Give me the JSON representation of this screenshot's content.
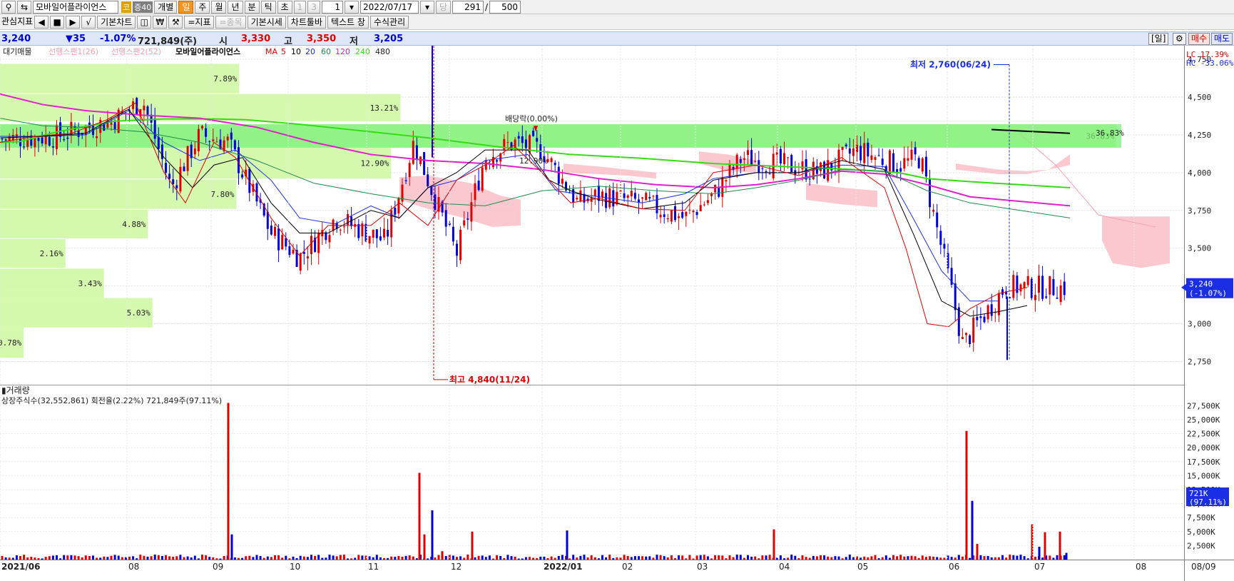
{
  "toolbar": {
    "stock_name": "모바일어플라이언스",
    "badge_market": "코",
    "badge_margin": "증40",
    "individual": "개별",
    "periods": [
      "일",
      "주",
      "월",
      "년",
      "분",
      "틱",
      "초"
    ],
    "active_period": "일",
    "spin_value": "1",
    "dis_one": "1",
    "dis_three": "3",
    "date": "2022/07/17",
    "dang_label": "당",
    "count": "291",
    "slash": "/",
    "total": "500",
    "btn_watchlist": "관심지표",
    "btn_basic_chart": "기본차트",
    "btn_indicator": "=지표",
    "btn_item": "=종목",
    "btn_basic_quote": "기본시세",
    "btn_chart_toolbar": "차트툴바",
    "btn_text_tool": "텍스트 창",
    "btn_formula": "수식관리"
  },
  "info": {
    "price": "3,240",
    "change": "▼35",
    "change_pct": "-1.07%",
    "volume": "721,849(주)",
    "open_label": "시",
    "open": "3,330",
    "high_label": "고",
    "high": "3,350",
    "low_label": "저",
    "low": "3,205",
    "period_btn": "[일]",
    "buy_btn": "매수",
    "sell_btn": "매도"
  },
  "colors": {
    "up": "#e00000",
    "down": "#0000d8",
    "ma5": "#e00000",
    "ma10": "#000000",
    "ma20": "#1a2ee6",
    "ma60": "#1f8a4a",
    "ma120": "#e020c8",
    "ma240": "#33dd11",
    "volume_profile": "#ccf7a0",
    "cloud": "#fbbec8"
  },
  "chart_data": [
    {
      "type": "candlestick",
      "legend": [
        "대기매물",
        "선행스팬1(26)",
        "선행스팬2(52)",
        "모바일어플라이언스",
        "MA",
        "5",
        "10",
        "20",
        "60",
        "120",
        "240",
        "480"
      ],
      "y_ticks": [
        2750,
        3000,
        3250,
        3500,
        3750,
        4000,
        4250,
        4500,
        4750
      ],
      "ylim": [
        2620,
        4840
      ],
      "x_ticks": [
        "2021/06",
        "08",
        "09",
        "10",
        "11",
        "12",
        "2022/01",
        "02",
        "03",
        "04",
        "05",
        "06",
        "07",
        "08",
        "08/09"
      ],
      "overlay_legend": [
        "LC 17.39%",
        "HC -33.06%"
      ],
      "price_flag": [
        "3,240",
        "(-1.07%)"
      ],
      "annotations": {
        "high": "최고 4,840(11/24)",
        "low": "최저 2,760(06/24)",
        "dividend": "배당락(0.00%)",
        "dividend_pct": "12.90%",
        "band_pct": "36.83%"
      },
      "volume_profile": [
        {
          "low": 4165,
          "high": 4320,
          "pct": "36.83%"
        },
        {
          "low": 3960,
          "high": 4165,
          "pct": "12.90%"
        },
        {
          "low": 4340,
          "high": 4520,
          "pct": "13.21%"
        },
        {
          "low": 4525,
          "high": 4720,
          "pct": "7.89%"
        },
        {
          "low": 3760,
          "high": 3955,
          "pct": "7.80%"
        },
        {
          "low": 3565,
          "high": 3755,
          "pct": "4.88%"
        },
        {
          "low": 3370,
          "high": 3560,
          "pct": "2.16%"
        },
        {
          "low": 3170,
          "high": 3365,
          "pct": "3.43%"
        },
        {
          "low": 2975,
          "high": 3170,
          "pct": "5.03%"
        },
        {
          "low": 2775,
          "high": 2975,
          "pct": "0.78%"
        }
      ],
      "ma240": [
        [
          0,
          4200
        ],
        [
          28,
          4205
        ],
        [
          80,
          4270
        ],
        [
          160,
          4340
        ],
        [
          230,
          4355
        ],
        [
          300,
          4355
        ],
        [
          345,
          4350
        ],
        [
          420,
          4320
        ],
        [
          500,
          4280
        ],
        [
          600,
          4230
        ],
        [
          700,
          4170
        ],
        [
          800,
          4120
        ],
        [
          900,
          4095
        ],
        [
          1000,
          4060
        ],
        [
          1100,
          4040
        ],
        [
          1200,
          4020
        ],
        [
          1260,
          4000
        ],
        [
          1300,
          3960
        ],
        [
          1360,
          3940
        ],
        [
          1500,
          3900
        ]
      ],
      "ma120": [
        [
          0,
          4520
        ],
        [
          60,
          4450
        ],
        [
          120,
          4410
        ],
        [
          200,
          4380
        ],
        [
          280,
          4360
        ],
        [
          360,
          4300
        ],
        [
          440,
          4200
        ],
        [
          520,
          4120
        ],
        [
          600,
          4080
        ],
        [
          680,
          4060
        ],
        [
          760,
          4020
        ],
        [
          840,
          3960
        ],
        [
          920,
          3920
        ],
        [
          1000,
          3900
        ],
        [
          1060,
          3920
        ],
        [
          1120,
          3960
        ],
        [
          1180,
          4010
        ],
        [
          1240,
          3990
        ],
        [
          1300,
          3920
        ],
        [
          1360,
          3840
        ],
        [
          1500,
          3780
        ]
      ],
      "ma60": [
        [
          0,
          4360
        ],
        [
          60,
          4310
        ],
        [
          120,
          4300
        ],
        [
          200,
          4270
        ],
        [
          280,
          4200
        ],
        [
          360,
          4080
        ],
        [
          440,
          3930
        ],
        [
          520,
          3860
        ],
        [
          600,
          3800
        ],
        [
          680,
          3780
        ],
        [
          760,
          3880
        ],
        [
          840,
          3910
        ],
        [
          920,
          3880
        ],
        [
          1000,
          3860
        ],
        [
          1060,
          3900
        ],
        [
          1120,
          3950
        ],
        [
          1180,
          4020
        ],
        [
          1240,
          4010
        ],
        [
          1300,
          3880
        ],
        [
          1360,
          3800
        ],
        [
          1500,
          3700
        ]
      ],
      "ma20": [
        [
          0,
          4240
        ],
        [
          60,
          4240
        ],
        [
          120,
          4250
        ],
        [
          180,
          4410
        ],
        [
          230,
          4200
        ],
        [
          280,
          4080
        ],
        [
          330,
          4150
        ],
        [
          380,
          3950
        ],
        [
          420,
          3700
        ],
        [
          470,
          3660
        ],
        [
          520,
          3780
        ],
        [
          560,
          3700
        ],
        [
          600,
          3900
        ],
        [
          640,
          3950
        ],
        [
          680,
          4080
        ],
        [
          740,
          4120
        ],
        [
          780,
          3880
        ],
        [
          840,
          3840
        ],
        [
          900,
          3800
        ],
        [
          960,
          3860
        ],
        [
          1000,
          3960
        ],
        [
          1060,
          4000
        ],
        [
          1120,
          4000
        ],
        [
          1180,
          4050
        ],
        [
          1240,
          4040
        ],
        [
          1280,
          3700
        ],
        [
          1320,
          3350
        ],
        [
          1360,
          3150
        ],
        [
          1400,
          3150
        ]
      ],
      "ma10": [
        [
          0,
          4230
        ],
        [
          60,
          4240
        ],
        [
          120,
          4260
        ],
        [
          180,
          4420
        ],
        [
          230,
          4100
        ],
        [
          270,
          3900
        ],
        [
          300,
          4050
        ],
        [
          340,
          4100
        ],
        [
          380,
          3800
        ],
        [
          420,
          3600
        ],
        [
          460,
          3600
        ],
        [
          520,
          3750
        ],
        [
          560,
          3700
        ],
        [
          600,
          3900
        ],
        [
          640,
          4000
        ],
        [
          680,
          4150
        ],
        [
          740,
          4150
        ],
        [
          770,
          3950
        ],
        [
          800,
          3880
        ],
        [
          840,
          3820
        ],
        [
          900,
          3760
        ],
        [
          960,
          3800
        ],
        [
          1000,
          3950
        ],
        [
          1060,
          4000
        ],
        [
          1120,
          4000
        ],
        [
          1180,
          4080
        ],
        [
          1240,
          4020
        ],
        [
          1280,
          3600
        ],
        [
          1320,
          3150
        ],
        [
          1360,
          3050
        ],
        [
          1400,
          3080
        ],
        [
          1440,
          3120
        ]
      ],
      "ma5": [
        [
          0,
          4200
        ],
        [
          50,
          4240
        ],
        [
          100,
          4260
        ],
        [
          150,
          4350
        ],
        [
          190,
          4460
        ],
        [
          230,
          4000
        ],
        [
          260,
          3800
        ],
        [
          300,
          4200
        ],
        [
          330,
          4100
        ],
        [
          380,
          3700
        ],
        [
          420,
          3450
        ],
        [
          460,
          3650
        ],
        [
          520,
          3650
        ],
        [
          560,
          3800
        ],
        [
          600,
          3650
        ],
        [
          640,
          3950
        ],
        [
          680,
          4050
        ],
        [
          720,
          4180
        ],
        [
          760,
          4000
        ],
        [
          800,
          3800
        ],
        [
          840,
          3830
        ],
        [
          900,
          3760
        ],
        [
          960,
          3750
        ],
        [
          1000,
          4000
        ],
        [
          1060,
          4050
        ],
        [
          1120,
          3980
        ],
        [
          1180,
          4100
        ],
        [
          1240,
          3900
        ],
        [
          1270,
          3500
        ],
        [
          1300,
          3000
        ],
        [
          1330,
          2980
        ],
        [
          1360,
          3100
        ],
        [
          1400,
          3200
        ],
        [
          1440,
          3240
        ]
      ],
      "close_path": [
        [
          0,
          4220
        ],
        [
          80,
          4240
        ],
        [
          160,
          4350
        ],
        [
          200,
          4480
        ],
        [
          240,
          3900
        ],
        [
          280,
          4250
        ],
        [
          320,
          4200
        ],
        [
          380,
          3600
        ],
        [
          420,
          3440
        ],
        [
          470,
          3700
        ],
        [
          540,
          3550
        ],
        [
          580,
          4200
        ],
        [
          600,
          3950
        ],
        [
          640,
          3460
        ],
        [
          680,
          4100
        ],
        [
          720,
          4200
        ],
        [
          760,
          4150
        ],
        [
          810,
          3800
        ],
        [
          840,
          3850
        ],
        [
          900,
          3800
        ],
        [
          960,
          3700
        ],
        [
          1000,
          3850
        ],
        [
          1040,
          4100
        ],
        [
          1100,
          4050
        ],
        [
          1150,
          4000
        ],
        [
          1200,
          4150
        ],
        [
          1260,
          4050
        ],
        [
          1290,
          4100
        ],
        [
          1310,
          3700
        ],
        [
          1330,
          3300
        ],
        [
          1350,
          2860
        ],
        [
          1370,
          3000
        ],
        [
          1390,
          3120
        ],
        [
          1410,
          3250
        ],
        [
          1440,
          3240
        ]
      ],
      "upper_cloud_line": [
        [
          1430,
          4255
        ],
        [
          1480,
          4050
        ],
        [
          1540,
          3720
        ],
        [
          1620,
          3640
        ]
      ],
      "resistance_line": [
        [
          1390,
          4285
        ],
        [
          1500,
          4260
        ]
      ]
    },
    {
      "type": "bar",
      "title": "거래량",
      "subtitle": "상장주식수(32,552,861) 회전율(2.22%) 721,849주(97.11%)",
      "y_ticks": [
        2500,
        5000,
        7500,
        10000,
        12500,
        15000,
        17500,
        20000,
        22500,
        25000,
        27500
      ],
      "y_tick_labels": [
        "2,500K",
        "5,000K",
        "7,500K",
        "10,000K",
        "12,500K",
        "15,000K",
        "17,500K",
        "20,000K",
        "22,500K",
        "25,000K",
        "27,500K"
      ],
      "ylim": [
        0,
        28700
      ],
      "volume_flag": [
        "721K",
        "(97.11%)"
      ],
      "spikes": [
        [
          320,
          28000
        ],
        [
          325,
          4500
        ],
        [
          588,
          15500
        ],
        [
          595,
          4500
        ],
        [
          606,
          8800
        ],
        [
          620,
          1500
        ],
        [
          662,
          5000
        ],
        [
          795,
          5200
        ],
        [
          1085,
          5400
        ],
        [
          1355,
          23000
        ],
        [
          1363,
          10500
        ],
        [
          1370,
          2800
        ],
        [
          1447,
          6300
        ],
        [
          1457,
          2300
        ],
        [
          1465,
          4900
        ],
        [
          1486,
          5000
        ],
        [
          1495,
          1200
        ]
      ],
      "baseline_avg": 450
    }
  ]
}
